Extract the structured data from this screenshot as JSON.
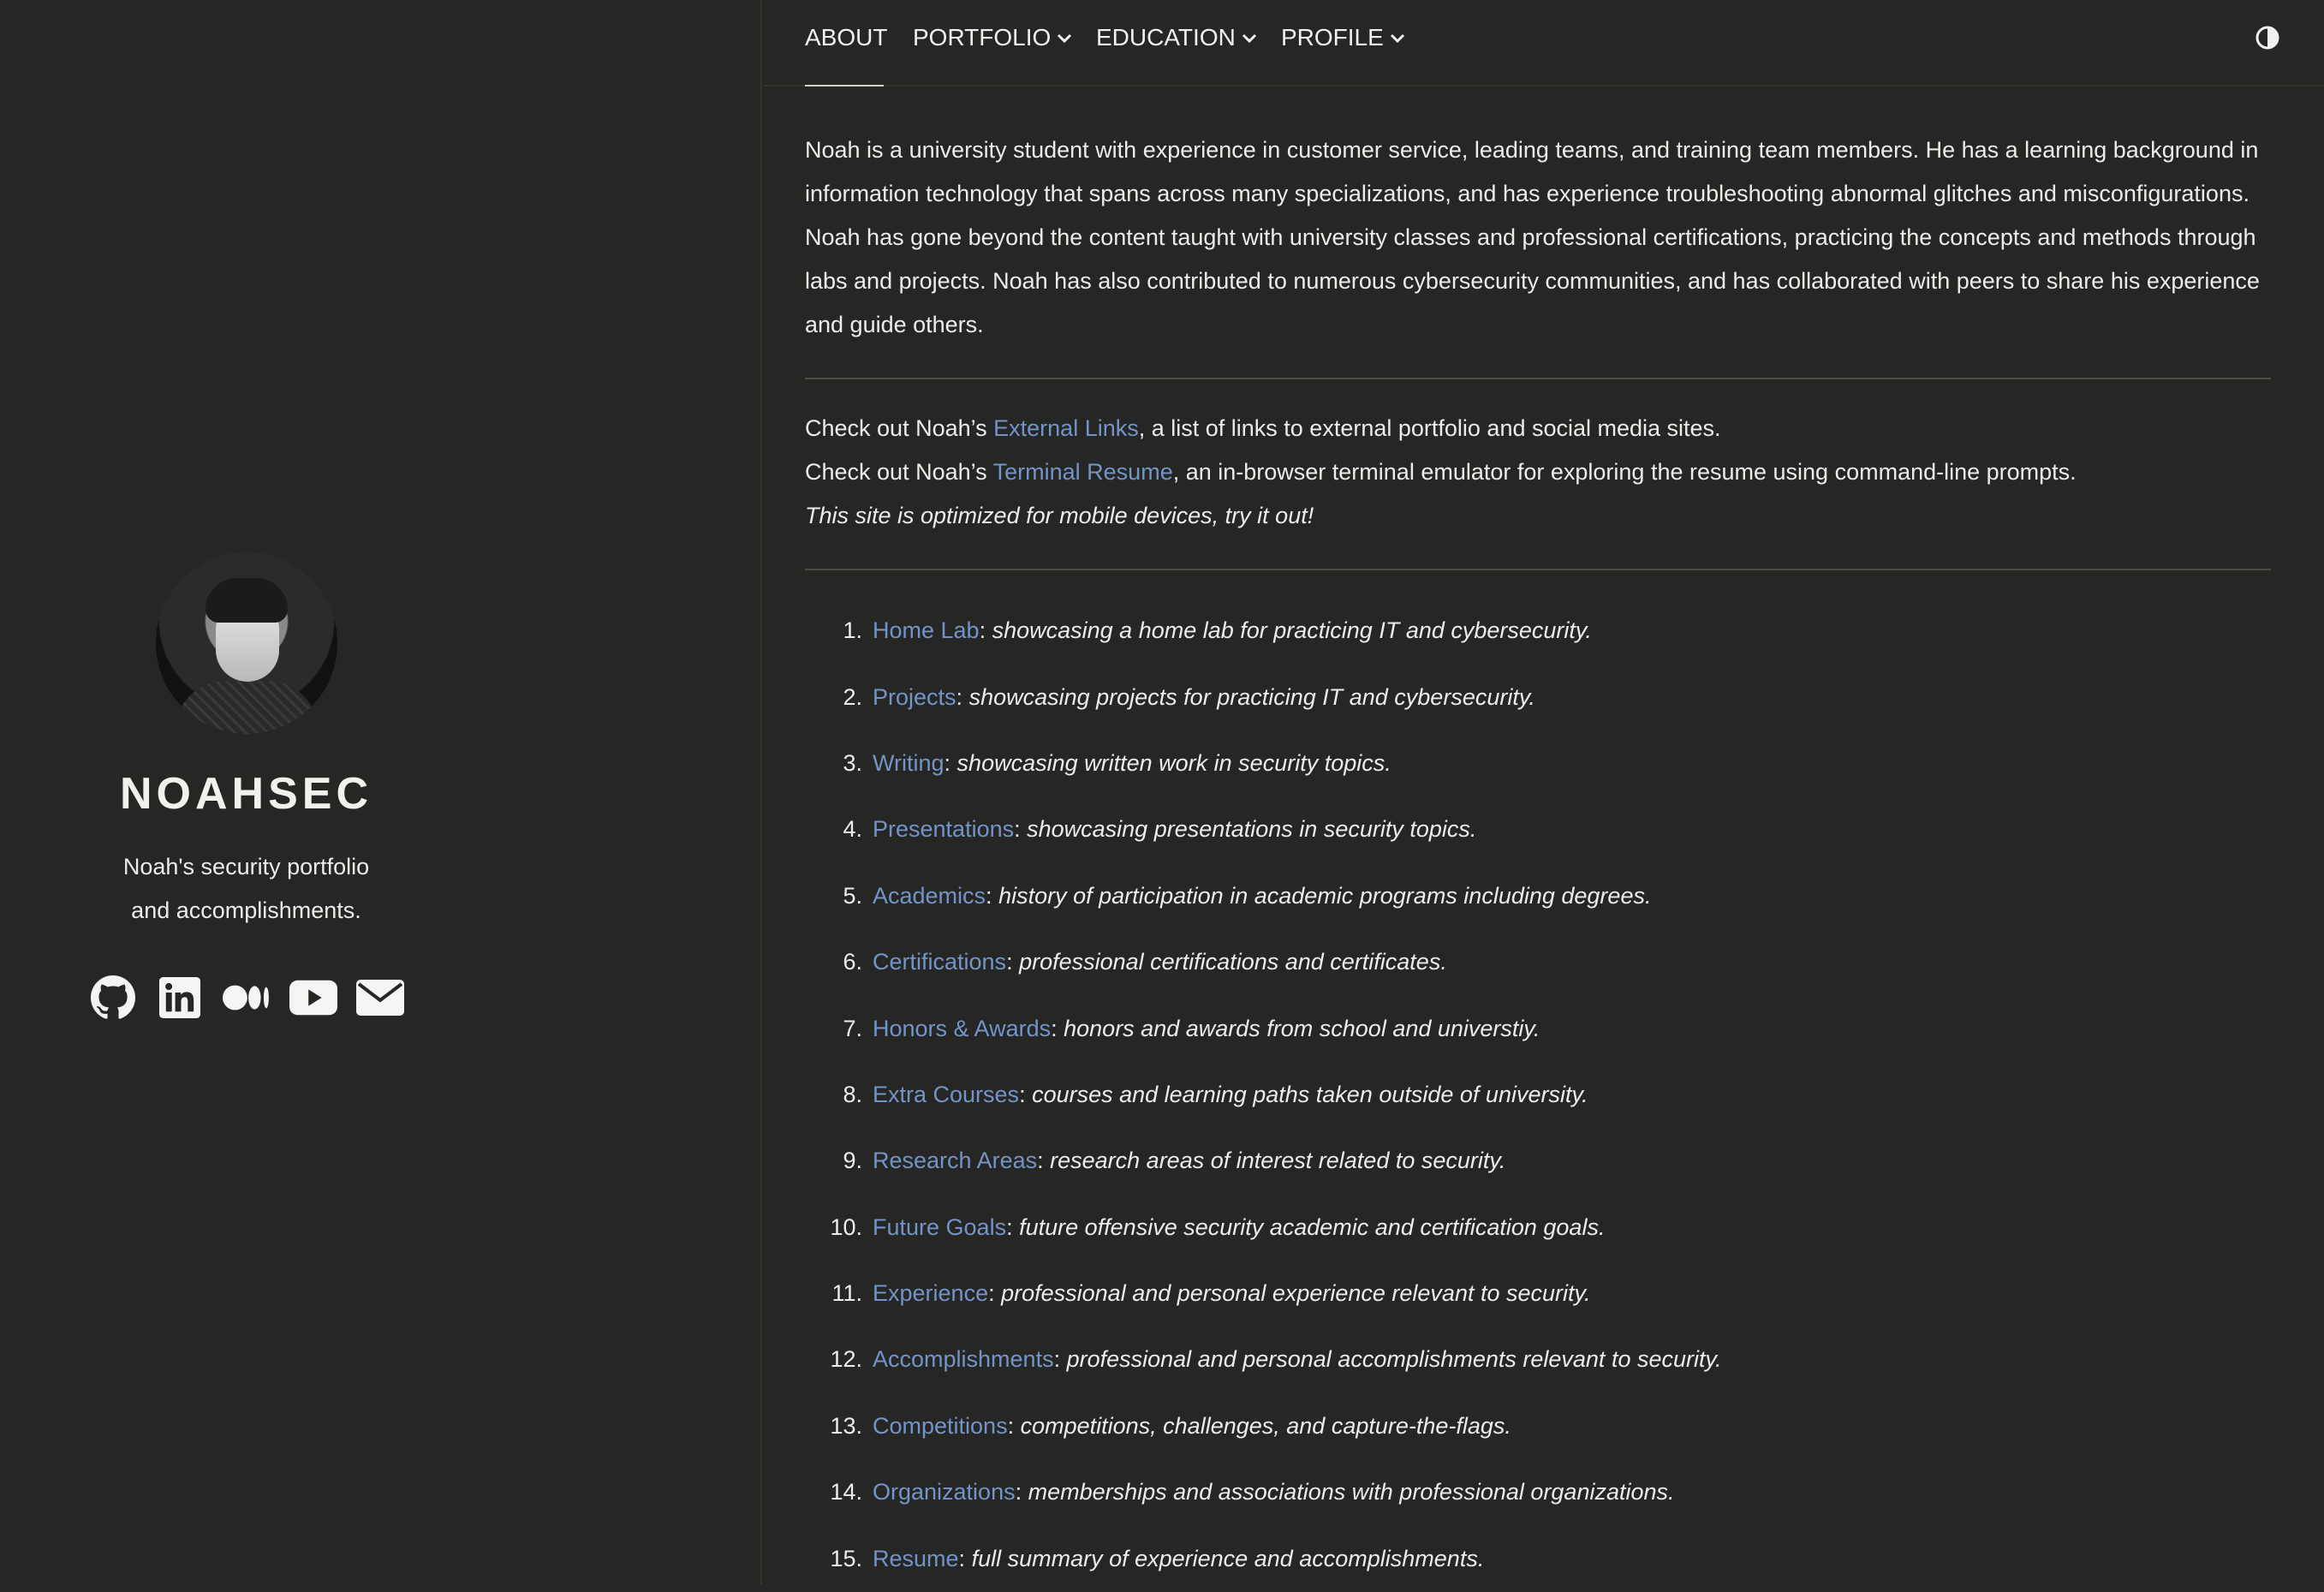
{
  "sidebar": {
    "site_title": "NOAHSEC",
    "tagline_line1": "Noah's security portfolio",
    "tagline_line2": "and accomplishments.",
    "socials": [
      {
        "icon": "github-icon"
      },
      {
        "icon": "linkedin-icon"
      },
      {
        "icon": "medium-icon"
      },
      {
        "icon": "youtube-icon"
      },
      {
        "icon": "envelope-icon"
      }
    ]
  },
  "nav": {
    "about": "ABOUT",
    "portfolio": "PORTFOLIO",
    "education": "EDUCATION",
    "profile": "PROFILE",
    "theme_icon": "contrast-icon"
  },
  "about": {
    "paragraph": "Noah is a university student with experience in customer service, leading teams, and training team members. He has a learning background in information technology that spans across many specializations, and has experience troubleshooting abnormal glitches and misconfigurations. Noah has gone beyond the content taught with university classes and professional certifications, practicing the concepts and methods through labs and projects. Noah has also contributed to numerous cybersecurity communities, and has collaborated with peers to share his experience and guide others.",
    "line1_prefix": "Check out Noah’s ",
    "line1_link": "External Links",
    "line1_suffix": ", a list of links to external portfolio and social media sites.",
    "line2_prefix": "Check out Noah’s ",
    "line2_link": "Terminal Resume",
    "line2_suffix": ", an in-browser terminal emulator for exploring the resume using command-line prompts.",
    "mobile_note": "This site is optimized for mobile devices, try it out!"
  },
  "sections": [
    {
      "num": "1.",
      "link": "Home Lab",
      "desc": "showcasing a home lab for practicing IT and cybersecurity."
    },
    {
      "num": "2.",
      "link": "Projects",
      "desc": "showcasing projects for practicing IT and cybersecurity."
    },
    {
      "num": "3.",
      "link": "Writing",
      "desc": "showcasing written work in security topics."
    },
    {
      "num": "4.",
      "link": "Presentations",
      "desc": "showcasing presentations in security topics."
    },
    {
      "num": "5.",
      "link": "Academics",
      "desc": "history of participation in academic programs including degrees."
    },
    {
      "num": "6.",
      "link": "Certifications",
      "desc": "professional certifications and certificates."
    },
    {
      "num": "7.",
      "link": "Honors & Awards",
      "desc": "honors and awards from school and universtiy."
    },
    {
      "num": "8.",
      "link": "Extra Courses",
      "desc": "courses and learning paths taken outside of university."
    },
    {
      "num": "9.",
      "link": "Research Areas",
      "desc": "research areas of interest related to security."
    },
    {
      "num": "10.",
      "link": "Future Goals",
      "desc": "future offensive security academic and certification goals."
    },
    {
      "num": "11.",
      "link": "Experience",
      "desc": "professional and personal experience relevant to security."
    },
    {
      "num": "12.",
      "link": "Accomplishments",
      "desc": "professional and personal accomplishments relevant to security."
    },
    {
      "num": "13.",
      "link": "Competitions",
      "desc": "competitions, challenges, and capture-the-flags."
    },
    {
      "num": "14.",
      "link": "Organizations",
      "desc": "memberships and associations with professional organizations."
    },
    {
      "num": "15.",
      "link": "Resume",
      "desc": "full summary of experience and accomplishments."
    }
  ],
  "colors": {
    "background": "#262724",
    "link": "#7394c9",
    "text": "#ececea"
  }
}
